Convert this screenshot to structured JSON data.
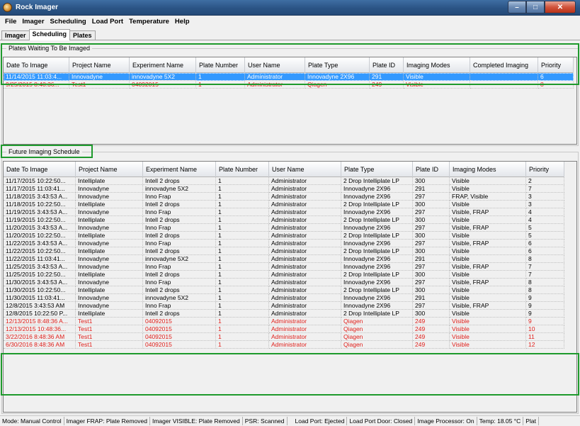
{
  "window": {
    "title": "Rock Imager",
    "minimize": "–",
    "maximize": "□",
    "close": "✕"
  },
  "menu": [
    "File",
    "Imager",
    "Scheduling",
    "Load Port",
    "Temperature",
    "Help"
  ],
  "tabs": [
    {
      "label": "Imager",
      "active": false
    },
    {
      "label": "Scheduling",
      "active": true
    },
    {
      "label": "Plates",
      "active": false
    }
  ],
  "waiting": {
    "title": "Plates Waiting To Be Imaged",
    "columns": [
      "Date To Image",
      "Project Name",
      "Experiment Name",
      "Plate Number",
      "User Name",
      "Plate Type",
      "Plate ID",
      "Imaging Modes",
      "Completed Imaging",
      "Priority"
    ],
    "rows": [
      {
        "style": "selected",
        "cells": [
          "11/14/2015  11:03:4...",
          "Innovadyne",
          "innovadyne 5X2",
          "1",
          "Administrator",
          "Innovadyne 2X96",
          "291",
          "Visible",
          "",
          "6"
        ]
      },
      {
        "style": "red",
        "cells": [
          "9/25/2015  8:48:36...",
          "Test1",
          "04092015",
          "1",
          "Administrator",
          "Qiagen",
          "249",
          "Visible",
          "",
          "8"
        ]
      }
    ]
  },
  "future": {
    "title": "Future Imaging Schedule",
    "columns": [
      "Date To Image",
      "Project Name",
      "Experiment Name",
      "Plate Number",
      "User Name",
      "Plate Type",
      "Plate ID",
      "Imaging Modes",
      "Priority"
    ],
    "rows": [
      {
        "style": "normal",
        "cells": [
          "11/17/2015  10:22:50...",
          "Intelliplate",
          "Intell 2 drops",
          "1",
          "Administrator",
          "2 Drop Intelliplate LP",
          "300",
          "Visible",
          "2"
        ]
      },
      {
        "style": "normal",
        "cells": [
          "11/17/2015  11:03:41...",
          "Innovadyne",
          "innovadyne 5X2",
          "1",
          "Administrator",
          "Innovadyne 2X96",
          "291",
          "Visible",
          "7"
        ]
      },
      {
        "style": "normal",
        "cells": [
          "11/18/2015  3:43:53 A...",
          "Innovadyne",
          "Inno Frap",
          "1",
          "Administrator",
          "Innovadyne 2X96",
          "297",
          "FRAP, Visible",
          "3"
        ]
      },
      {
        "style": "normal",
        "cells": [
          "11/18/2015  10:22:50...",
          "Intelliplate",
          "Intell 2 drops",
          "1",
          "Administrator",
          "2 Drop Intelliplate LP",
          "300",
          "Visible",
          "3"
        ]
      },
      {
        "style": "normal",
        "cells": [
          "11/19/2015  3:43:53 A...",
          "Innovadyne",
          "Inno Frap",
          "1",
          "Administrator",
          "Innovadyne 2X96",
          "297",
          "Visible, FRAP",
          "4"
        ]
      },
      {
        "style": "normal",
        "cells": [
          "11/19/2015  10:22:50...",
          "Intelliplate",
          "Intell 2 drops",
          "1",
          "Administrator",
          "2 Drop Intelliplate LP",
          "300",
          "Visible",
          "4"
        ]
      },
      {
        "style": "normal",
        "cells": [
          "11/20/2015  3:43:53 A...",
          "Innovadyne",
          "Inno Frap",
          "1",
          "Administrator",
          "Innovadyne 2X96",
          "297",
          "Visible, FRAP",
          "5"
        ]
      },
      {
        "style": "normal",
        "cells": [
          "11/20/2015  10:22:50...",
          "Intelliplate",
          "Intell 2 drops",
          "1",
          "Administrator",
          "2 Drop Intelliplate LP",
          "300",
          "Visible",
          "5"
        ]
      },
      {
        "style": "normal",
        "cells": [
          "11/22/2015  3:43:53 A...",
          "Innovadyne",
          "Inno Frap",
          "1",
          "Administrator",
          "Innovadyne 2X96",
          "297",
          "Visible, FRAP",
          "6"
        ]
      },
      {
        "style": "normal",
        "cells": [
          "11/22/2015  10:22:50...",
          "Intelliplate",
          "Intell 2 drops",
          "1",
          "Administrator",
          "2 Drop Intelliplate LP",
          "300",
          "Visible",
          "6"
        ]
      },
      {
        "style": "normal",
        "cells": [
          "11/22/2015  11:03:41...",
          "Innovadyne",
          "innovadyne 5X2",
          "1",
          "Administrator",
          "Innovadyne 2X96",
          "291",
          "Visible",
          "8"
        ]
      },
      {
        "style": "normal",
        "cells": [
          "11/25/2015  3:43:53 A...",
          "Innovadyne",
          "Inno Frap",
          "1",
          "Administrator",
          "Innovadyne 2X96",
          "297",
          "Visible, FRAP",
          "7"
        ]
      },
      {
        "style": "normal",
        "cells": [
          "11/25/2015  10:22:50...",
          "Intelliplate",
          "Intell 2 drops",
          "1",
          "Administrator",
          "2 Drop Intelliplate LP",
          "300",
          "Visible",
          "7"
        ]
      },
      {
        "style": "normal",
        "cells": [
          "11/30/2015  3:43:53 A...",
          "Innovadyne",
          "Inno Frap",
          "1",
          "Administrator",
          "Innovadyne 2X96",
          "297",
          "Visible, FRAP",
          "8"
        ]
      },
      {
        "style": "normal",
        "cells": [
          "11/30/2015  10:22:50...",
          "Intelliplate",
          "Intell 2 drops",
          "1",
          "Administrator",
          "2 Drop Intelliplate LP",
          "300",
          "Visible",
          "8"
        ]
      },
      {
        "style": "normal",
        "cells": [
          "11/30/2015  11:03:41...",
          "Innovadyne",
          "innovadyne 5X2",
          "1",
          "Administrator",
          "Innovadyne 2X96",
          "291",
          "Visible",
          "9"
        ]
      },
      {
        "style": "normal",
        "cells": [
          "12/8/2015 3:43:53 AM",
          "Innovadyne",
          "Inno Frap",
          "1",
          "Administrator",
          "Innovadyne 2X96",
          "297",
          "Visible, FRAP",
          "9"
        ]
      },
      {
        "style": "normal",
        "cells": [
          "12/8/2015  10:22:50 P...",
          "Intelliplate",
          "Intell 2 drops",
          "1",
          "Administrator",
          "2 Drop Intelliplate LP",
          "300",
          "Visible",
          "9"
        ]
      },
      {
        "style": "red",
        "cells": [
          "12/13/2015  8:48:36 A...",
          "Test1",
          "04092015",
          "1",
          "Administrator",
          "Qiagen",
          "249",
          "Visible",
          "9"
        ]
      },
      {
        "style": "red",
        "cells": [
          "12/13/2015  10:48:36...",
          "Test1",
          "04092015",
          "1",
          "Administrator",
          "Qiagen",
          "249",
          "Visible",
          "10"
        ]
      },
      {
        "style": "red",
        "cells": [
          "3/22/2016 8:48:36 AM",
          "Test1",
          "04092015",
          "1",
          "Administrator",
          "Qiagen",
          "249",
          "Visible",
          "11"
        ]
      },
      {
        "style": "red",
        "cells": [
          "6/30/2016 8:48:36 AM",
          "Test1",
          "04092015",
          "1",
          "Administrator",
          "Qiagen",
          "249",
          "Visible",
          "12"
        ]
      }
    ]
  },
  "status": [
    "Mode: Manual Control",
    "Imager FRAP: Plate Removed",
    "Imager VISIBLE: Plate Removed",
    "PSR: Scanned",
    "Load Port: Ejected",
    "Load Port Door: Closed",
    "Image Processor: On",
    "Temp: 18.05 °C",
    "Plat"
  ],
  "colors": {
    "highlight": "#1e9a2c",
    "selected_row": "#3399ff",
    "alert_text": "#e0201b"
  }
}
